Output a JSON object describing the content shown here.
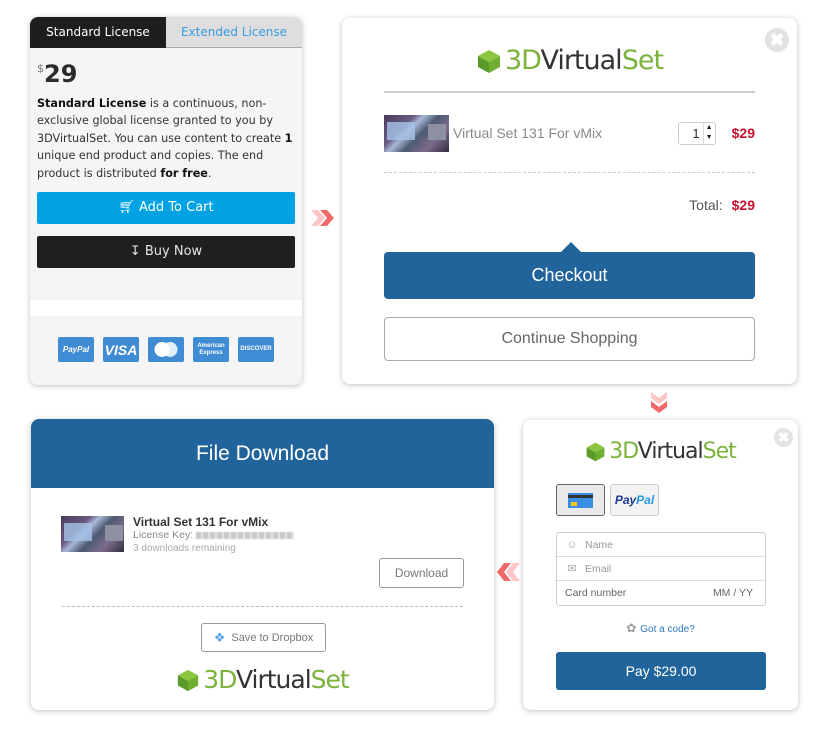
{
  "license_panel": {
    "tabs": [
      {
        "label": "Standard License",
        "active": true
      },
      {
        "label": "Extended License",
        "active": false
      }
    ],
    "currency_symbol": "$",
    "price": "29",
    "description": {
      "part1_bold": "Standard License",
      "part2": " is a continuous, non-exclusive global license granted to you by 3DVirtualSet. You can use content to create ",
      "part3_bold": "1",
      "part4": " unique end product and copies. The end product is distributed ",
      "part5_bold": "for free",
      "part6": "."
    },
    "add_to_cart_label": "Add To Cart",
    "buy_now_label": "Buy Now",
    "payment_logos": [
      "PayPal",
      "VISA",
      "MasterCard",
      "American Express",
      "DISCOVER"
    ],
    "accent_color": "#00a2e3"
  },
  "brand": {
    "logo_part1": "3D",
    "logo_part2": "Virtual",
    "logo_part3": "Set",
    "green": "#7bb33c"
  },
  "cart_panel": {
    "item_name": "Virtual Set 131 For vMix",
    "quantity": "1",
    "item_price": "$29",
    "total_label": "Total:",
    "total_value": "$29",
    "checkout_label": "Checkout",
    "continue_label": "Continue Shopping",
    "primary_color": "#21649b",
    "price_color": "#c8102e"
  },
  "payment_panel": {
    "methods": [
      "card",
      "PayPal"
    ],
    "paypal_pay": "Pay",
    "paypal_pal": "Pal",
    "name_placeholder": "Name",
    "email_placeholder": "Email",
    "card_placeholder": "Card number",
    "expiry_placeholder": "MM / YY",
    "code_link": "Got a code?",
    "pay_label": "Pay $29.00"
  },
  "download_panel": {
    "title": "File Download",
    "item_name": "Virtual Set 131 For vMix",
    "license_key_label": "License Key:",
    "downloads_remaining": "3 downloads remaining",
    "download_label": "Download",
    "dropbox_label": "Save to Dropbox"
  }
}
